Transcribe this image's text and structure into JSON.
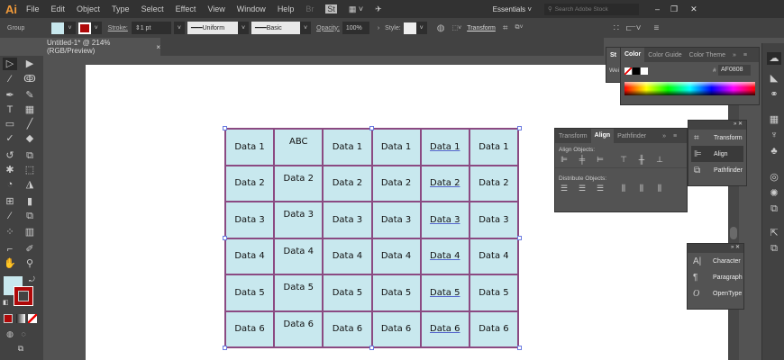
{
  "app": {
    "logo": "Ai",
    "menus": [
      "File",
      "Edit",
      "Object",
      "Type",
      "Select",
      "Effect",
      "View",
      "Window",
      "Help"
    ],
    "workspace": "Essentials",
    "search_placeholder": "Search Adobe Stock"
  },
  "control": {
    "selection": "Group",
    "stroke_label": "Stroke:",
    "stroke_value": "1 pt",
    "profile": "Uniform",
    "brush": "Basic",
    "opacity_label": "Opacity:",
    "opacity_value": "100%",
    "style_label": "Style:",
    "transform": "Transform",
    "fill_color": "#c8e8ee",
    "stroke_color": "#af0808"
  },
  "document": {
    "tab_title": "Untitled-1* @ 214% (RGB/Preview)",
    "close": "×"
  },
  "table": {
    "rows": [
      [
        "Data 1",
        "ABC",
        "Data 1",
        "Data 1",
        "Data 1",
        "Data 1"
      ],
      [
        "Data 2",
        "Data 2",
        "Data 2",
        "Data 2",
        "Data 2",
        "Data 2"
      ],
      [
        "Data 3",
        "Data 3",
        "Data 3",
        "Data 3",
        "Data 3",
        "Data 3"
      ],
      [
        "Data 4",
        "Data 4",
        "Data 4",
        "Data 4",
        "Data 4",
        "Data 4"
      ],
      [
        "Data 5",
        "Data 5",
        "Data 5",
        "Data 5",
        "Data 5",
        "Data 5"
      ],
      [
        "Data 6",
        "Data 6",
        "Data 6",
        "Data 6",
        "Data 6",
        "Data 6"
      ]
    ]
  },
  "color_panel": {
    "tab_stroke": "St",
    "tab_color": "Color",
    "tab_guide": "Color Guide",
    "tab_themes": "Color Theme",
    "weight_label": "Wei",
    "hex_label": "#",
    "hex_value": "AF0808"
  },
  "align_panel": {
    "tabs": [
      "Transform",
      "Align",
      "Pathfinder"
    ],
    "align_objects": "Align Objects:",
    "distribute_objects": "Distribute Objects:"
  },
  "mini_panel1": {
    "items": [
      "Transform",
      "Align",
      "Pathfinder"
    ]
  },
  "mini_panel2": {
    "items": [
      "Character",
      "Paragraph",
      "OpenType"
    ]
  }
}
